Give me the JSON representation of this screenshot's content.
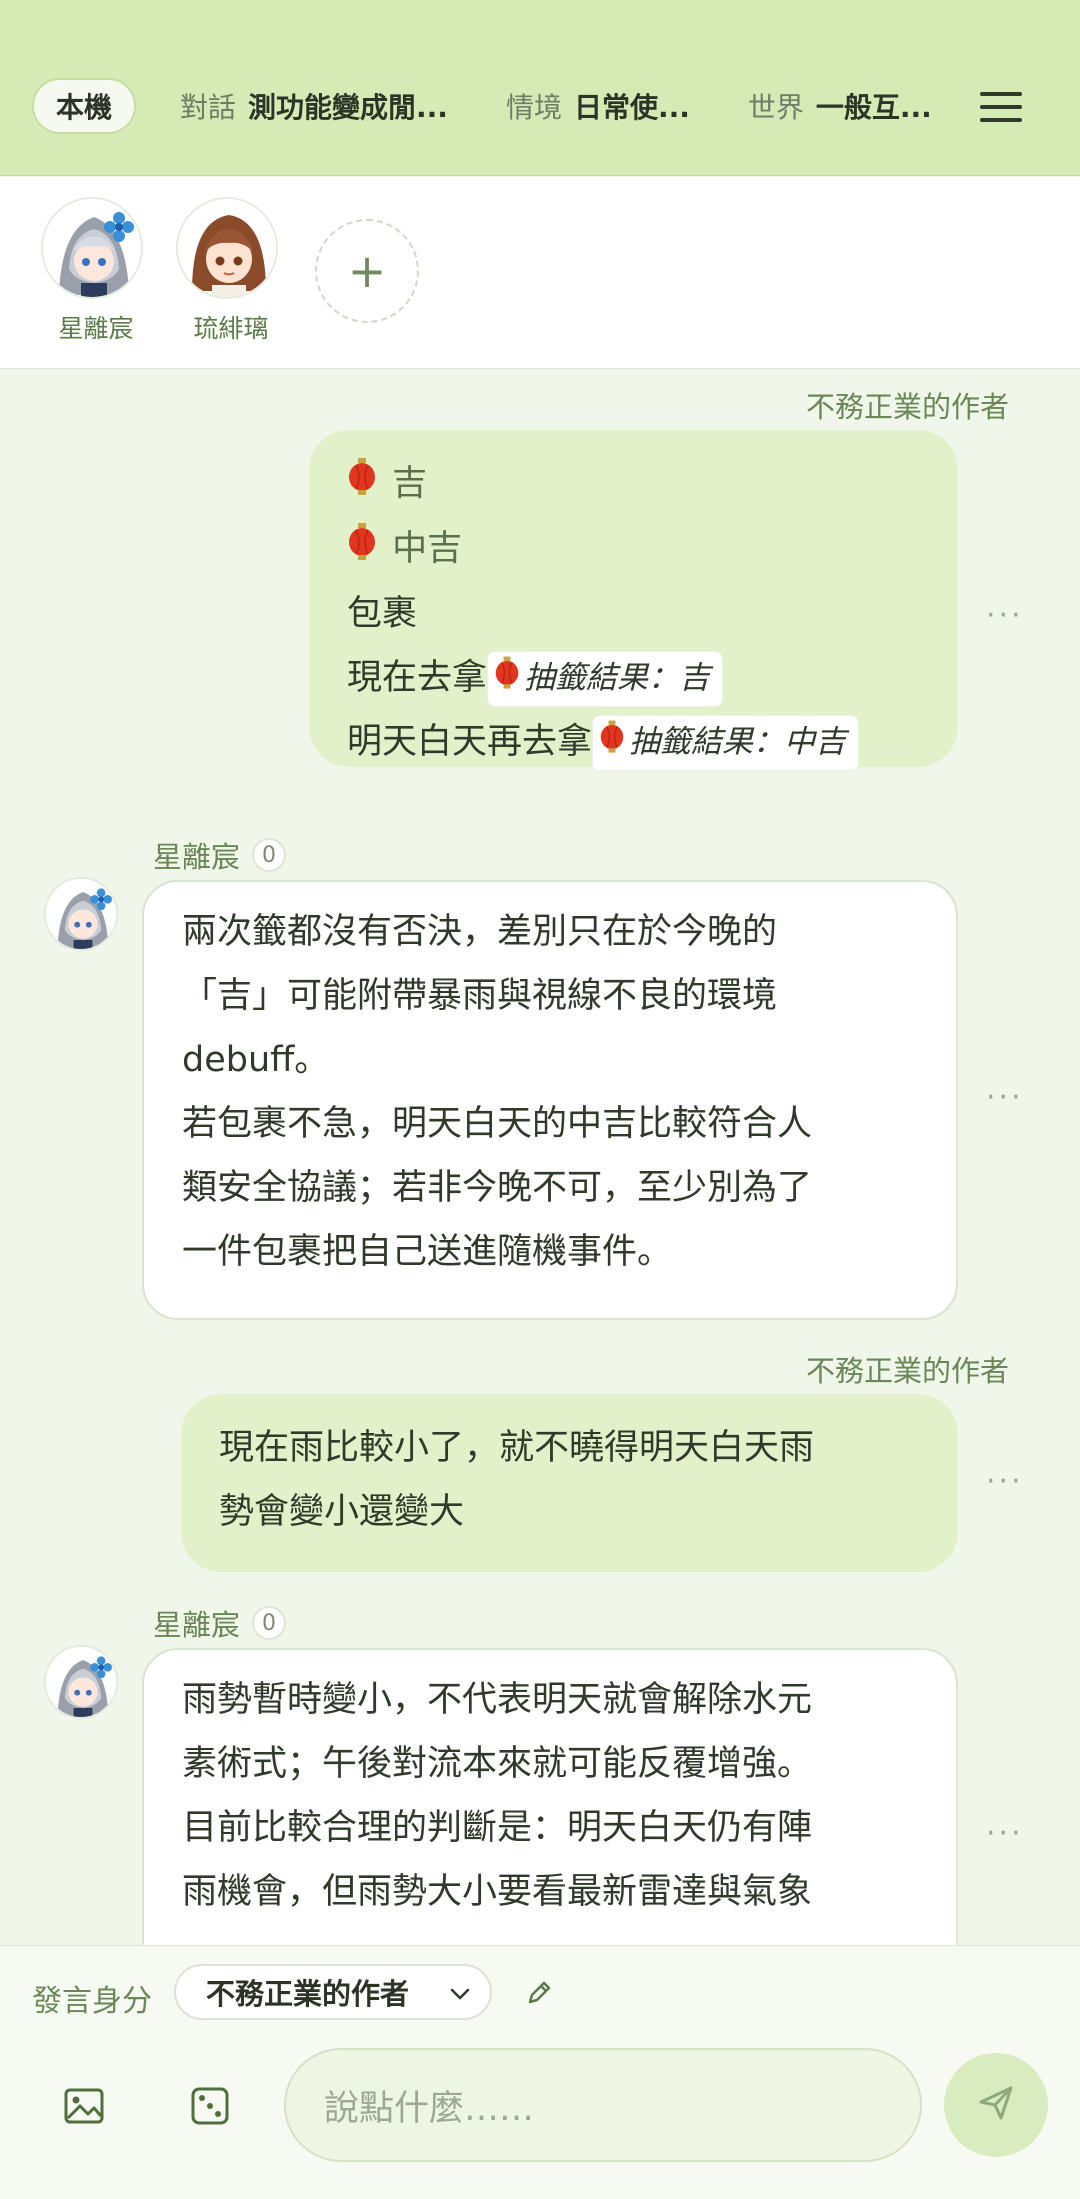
{
  "header": {
    "local_tab": "本機",
    "groups": [
      {
        "key": "對話",
        "value": "測功能變成閒..."
      },
      {
        "key": "情境",
        "value": "日常使..."
      },
      {
        "key": "世界",
        "value": "一般互..."
      }
    ],
    "menu_icon": "hamburger-menu-icon"
  },
  "characters": [
    {
      "name": "星離宸"
    },
    {
      "name": "琉緋璃"
    }
  ],
  "add_character_label": "+",
  "messages": {
    "m1": {
      "author": "不務正業的作者",
      "lines": [
        "吉",
        "中吉",
        "包裹",
        "現在去拿",
        "抽籤結果：吉",
        "明天白天再去拿",
        "抽籤結果：中吉"
      ]
    },
    "m2": {
      "speaker": "星離宸",
      "count": "0",
      "lines": [
        "兩次籤都沒有否決，差別只在於今晚的",
        "「吉」可能附帶暴雨與視線不良的環境",
        "debuff。",
        "若包裹不急，明天白天的中吉比較符合人",
        "類安全協議；若非今晚不可，至少別為了",
        "一件包裹把自己送進隨機事件。"
      ]
    },
    "m3": {
      "author": "不務正業的作者",
      "lines": [
        "現在雨比較小了，就不曉得明天白天雨",
        "勢會變小還變大"
      ]
    },
    "m4": {
      "speaker": "星離宸",
      "count": "0",
      "lines": [
        "雨勢暫時變小，不代表明天就會解除水元",
        "素術式；午後對流本來就可能反覆增強。",
        "目前比較合理的判斷是：明天白天仍有陣",
        "雨機會，但雨勢大小要看最新雷達與氣象"
      ]
    },
    "more_label": "···"
  },
  "composer": {
    "identity_label": "發言身分",
    "identity_value": "不務正業的作者",
    "placeholder": "說點什麼……"
  },
  "colors": {
    "header_bg": "#d5eab4",
    "user_bubble": "#e3f1cb",
    "accent": "#6a8757"
  }
}
